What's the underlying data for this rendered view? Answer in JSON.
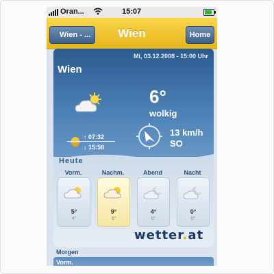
{
  "status_bar": {
    "carrier": "Oran...",
    "time": "15:07"
  },
  "nav": {
    "back_label": "Wien - ...",
    "title": "Wien",
    "home_label": "Home"
  },
  "weather": {
    "datetime": "Mi, 03.12.2008 - 15:00 Uhr",
    "city": "Wien",
    "temperature": "6°",
    "condition": "wolkig",
    "sunrise": "↑ 07:32",
    "sunset": "↓ 15:58",
    "wind_speed": "13 km/h",
    "wind_direction": "SO"
  },
  "today": {
    "label": "Heute",
    "periods": [
      {
        "label": "Vorm.",
        "temp": "5°",
        "sub": "4°",
        "icon": "partly-cloudy-icon"
      },
      {
        "label": "Nachm.",
        "temp": "9°",
        "sub": "6°",
        "icon": "partly-cloudy-icon"
      },
      {
        "label": "Abend",
        "temp": "4°",
        "sub": "0°",
        "icon": "moon-cloud-icon"
      },
      {
        "label": "Nacht",
        "temp": "0°",
        "sub": "0°",
        "icon": "moon-cloud-icon"
      }
    ]
  },
  "brand": {
    "name": "wetter",
    "dot": ".",
    "tld": "at"
  },
  "tomorrow": {
    "label": "Morgen",
    "first_period": "Vorm."
  },
  "colors": {
    "accent": "#f1c933",
    "nav_button": "#4a6c95",
    "card_top": "#2b5a8e",
    "brand": "#1f3a64"
  }
}
